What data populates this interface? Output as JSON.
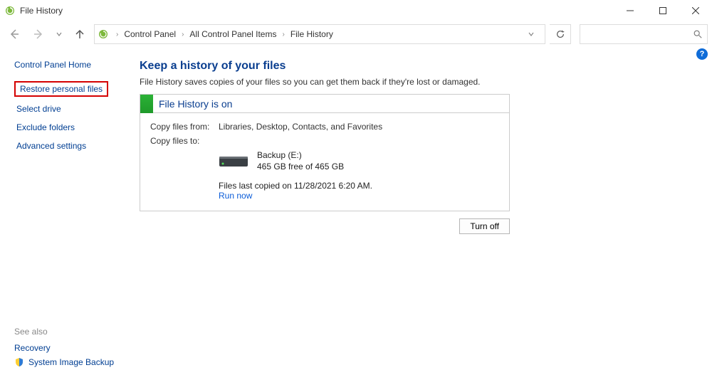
{
  "window": {
    "title": "File History"
  },
  "breadcrumb": {
    "root": "Control Panel",
    "mid": "All Control Panel Items",
    "leaf": "File History"
  },
  "sidebar": {
    "title": "Control Panel Home",
    "links": {
      "restore": "Restore personal files",
      "select_drive": "Select drive",
      "exclude": "Exclude folders",
      "advanced": "Advanced settings"
    },
    "see_also_label": "See also",
    "see_also": {
      "recovery": "Recovery",
      "sysimg": "System Image Backup"
    }
  },
  "main": {
    "heading": "Keep a history of your files",
    "subheading": "File History saves copies of your files so you can get them back if they're lost or damaged.",
    "status_title": "File History is on",
    "copy_from_label": "Copy files from:",
    "copy_from_value": "Libraries, Desktop, Contacts, and Favorites",
    "copy_to_label": "Copy files to:",
    "drive_label": "Backup (E:)",
    "drive_space": "465 GB free of 465 GB",
    "last_copied": "Files last copied on 11/28/2021 6:20 AM.",
    "run_now": "Run now",
    "turn_off": "Turn off",
    "help_badge": "?"
  }
}
